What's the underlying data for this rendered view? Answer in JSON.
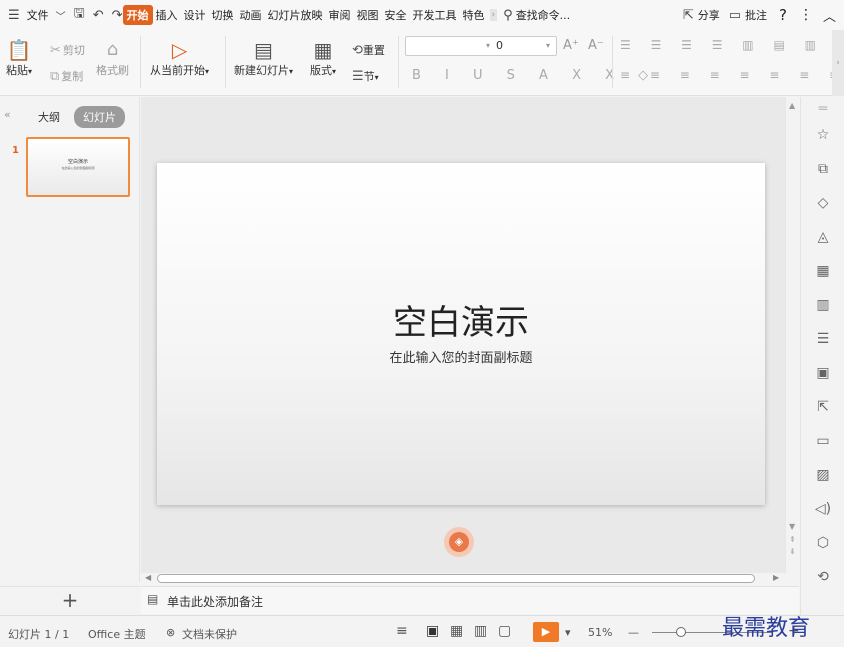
{
  "menubar": {
    "menu_icon": "☰",
    "file": "文件",
    "chevron": "﹀",
    "tabs": [
      "开始",
      "插入",
      "设计",
      "切换",
      "动画",
      "幻灯片放映",
      "审阅",
      "视图",
      "安全",
      "开发工具",
      "特色"
    ],
    "search": "查找命令...",
    "share": "分享",
    "comment": "批注",
    "help": "?",
    "more": "⋮",
    "collapse": "︿"
  },
  "ribbon": {
    "paste": "粘贴",
    "cut": "剪切",
    "copy": "复制",
    "format_painter": "格式刷",
    "play_from_current": "从当前开始",
    "new_slide": "新建幻灯片",
    "layout": "版式",
    "reset": "重置",
    "section": "节",
    "font_size": "0"
  },
  "left_panel": {
    "tab_outline": "大纲",
    "tab_slides": "幻灯片",
    "slide_number": "1",
    "add_slide": "+"
  },
  "slide": {
    "title": "空白演示",
    "subtitle": "在此输入您的封面副标题"
  },
  "notes": {
    "placeholder": "单击此处添加备注"
  },
  "status": {
    "slide_count": "幻灯片 1 / 1",
    "theme": "Office 主题",
    "protection": "文档未保护",
    "zoom": "51%",
    "minus": "—",
    "plus": "+"
  },
  "watermark": "最需教育",
  "colors": {
    "accent": "#e2621f",
    "play": "#f07a28",
    "watermark": "#2b3f9c"
  }
}
